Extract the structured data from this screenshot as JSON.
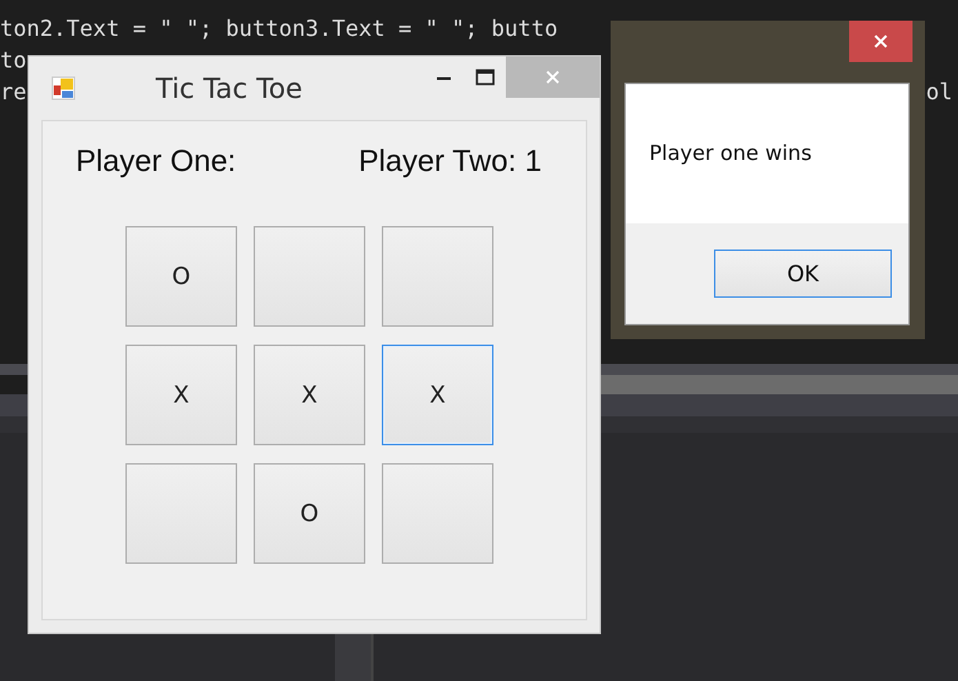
{
  "editor": {
    "code_lines": [
      {
        "left": "ton2.Text = \" \"; button3.Text = \" \"; butto"
      },
      {
        "left": "to"
      },
      {
        "left": "re",
        "right": "ol"
      }
    ]
  },
  "game_window": {
    "title": "Tic Tac Toe",
    "player_one_label": "Player One:",
    "player_two_label": "Player Two: 1",
    "cells": [
      {
        "mark": "O",
        "focused": false
      },
      {
        "focused": false
      },
      {
        "focused": false
      },
      {
        "mark": "X",
        "focused": false
      },
      {
        "mark": "X",
        "focused": false
      },
      {
        "mark": "X",
        "focused": true
      },
      {
        "focused": false
      },
      {
        "mark": "O",
        "focused": false
      },
      {
        "focused": false
      }
    ]
  },
  "message_box": {
    "message": "Player one wins",
    "buttons": [
      "OK"
    ]
  }
}
